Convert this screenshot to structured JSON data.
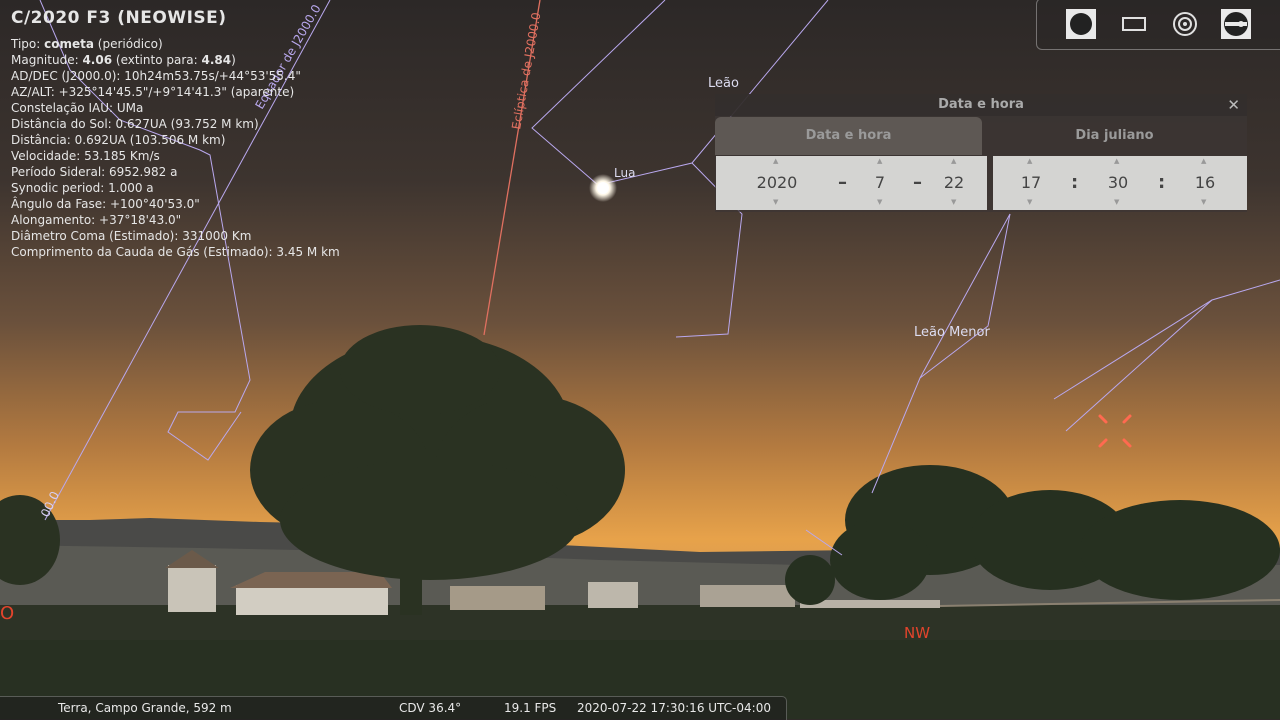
{
  "object": {
    "name": "C/2020 F3 (NEOWISE)",
    "type_label": "Tipo:",
    "type_value": "cometa",
    "type_extra": "(periódico)",
    "mag_label": "Magnitude:",
    "mag_value": "4.06",
    "mag_extra_label": "(extinto para:",
    "mag_extinct": "4.84",
    "mag_close": ")",
    "ra_dec": "AD/DEC (J2000.0): 10h24m53.75s/+44°53'55.4\"",
    "az_alt": "AZ/ALT: +325°14'45.5\"/+9°14'41.3\" (aparente)",
    "constellation": "Constelação IAU: UMa",
    "dist_sun": "Distância do Sol: 0.627UA (93.752 M km)",
    "distance": "Distância: 0.692UA (103.506 M km)",
    "velocity": "Velocidade: 53.185 Km/s",
    "sidereal_period": "Período Sideral: 6952.982 a",
    "synodic_period": "Synodic period: 1.000 a",
    "phase_angle": "Ângulo da Fase: +100°40'53.0\"",
    "elongation": "Alongamento: +37°18'43.0\"",
    "coma_diameter": "Diâmetro Coma (Estimado): 331000 Km",
    "tail_length": "Comprimento da Cauda de Gás (Estimado): 3.45 M km"
  },
  "sky_labels": {
    "leo": "Leão",
    "moon": "Lua",
    "leo_minor": "Leão Menor",
    "ecliptic": "Eclíptica de J2000.0",
    "equator": "Equador de J2000.0",
    "grid_value": "00.0",
    "cardinal_west": "O",
    "cardinal_nw": "NW"
  },
  "toolbar": {
    "icons": [
      "planet-icon",
      "rectangle-icon",
      "target-icon",
      "telescope-icon"
    ]
  },
  "date_dialog": {
    "title": "Data e hora",
    "close": "✕",
    "tab_datetime": "Data e hora",
    "tab_julian": "Dia juliano",
    "year": "2020",
    "month": "7",
    "day": "22",
    "hour": "17",
    "minute": "30",
    "second": "16",
    "date_sep": "–",
    "time_sep": ":"
  },
  "status_bar": {
    "location": "Terra, Campo Grande, 592 m",
    "fov": "CDV 36.4°",
    "fps": "19.1 FPS",
    "datetime": "2020-07-22 17:30:16 UTC-04:00"
  },
  "colors": {
    "sky_top": "#2e2a28",
    "sky_horizon": "#e7a24a",
    "ground": "#2b3324",
    "constellation_line": "#b9a8ee",
    "ecliptic_line": "#e07060",
    "cardinal": "#e2442c"
  }
}
